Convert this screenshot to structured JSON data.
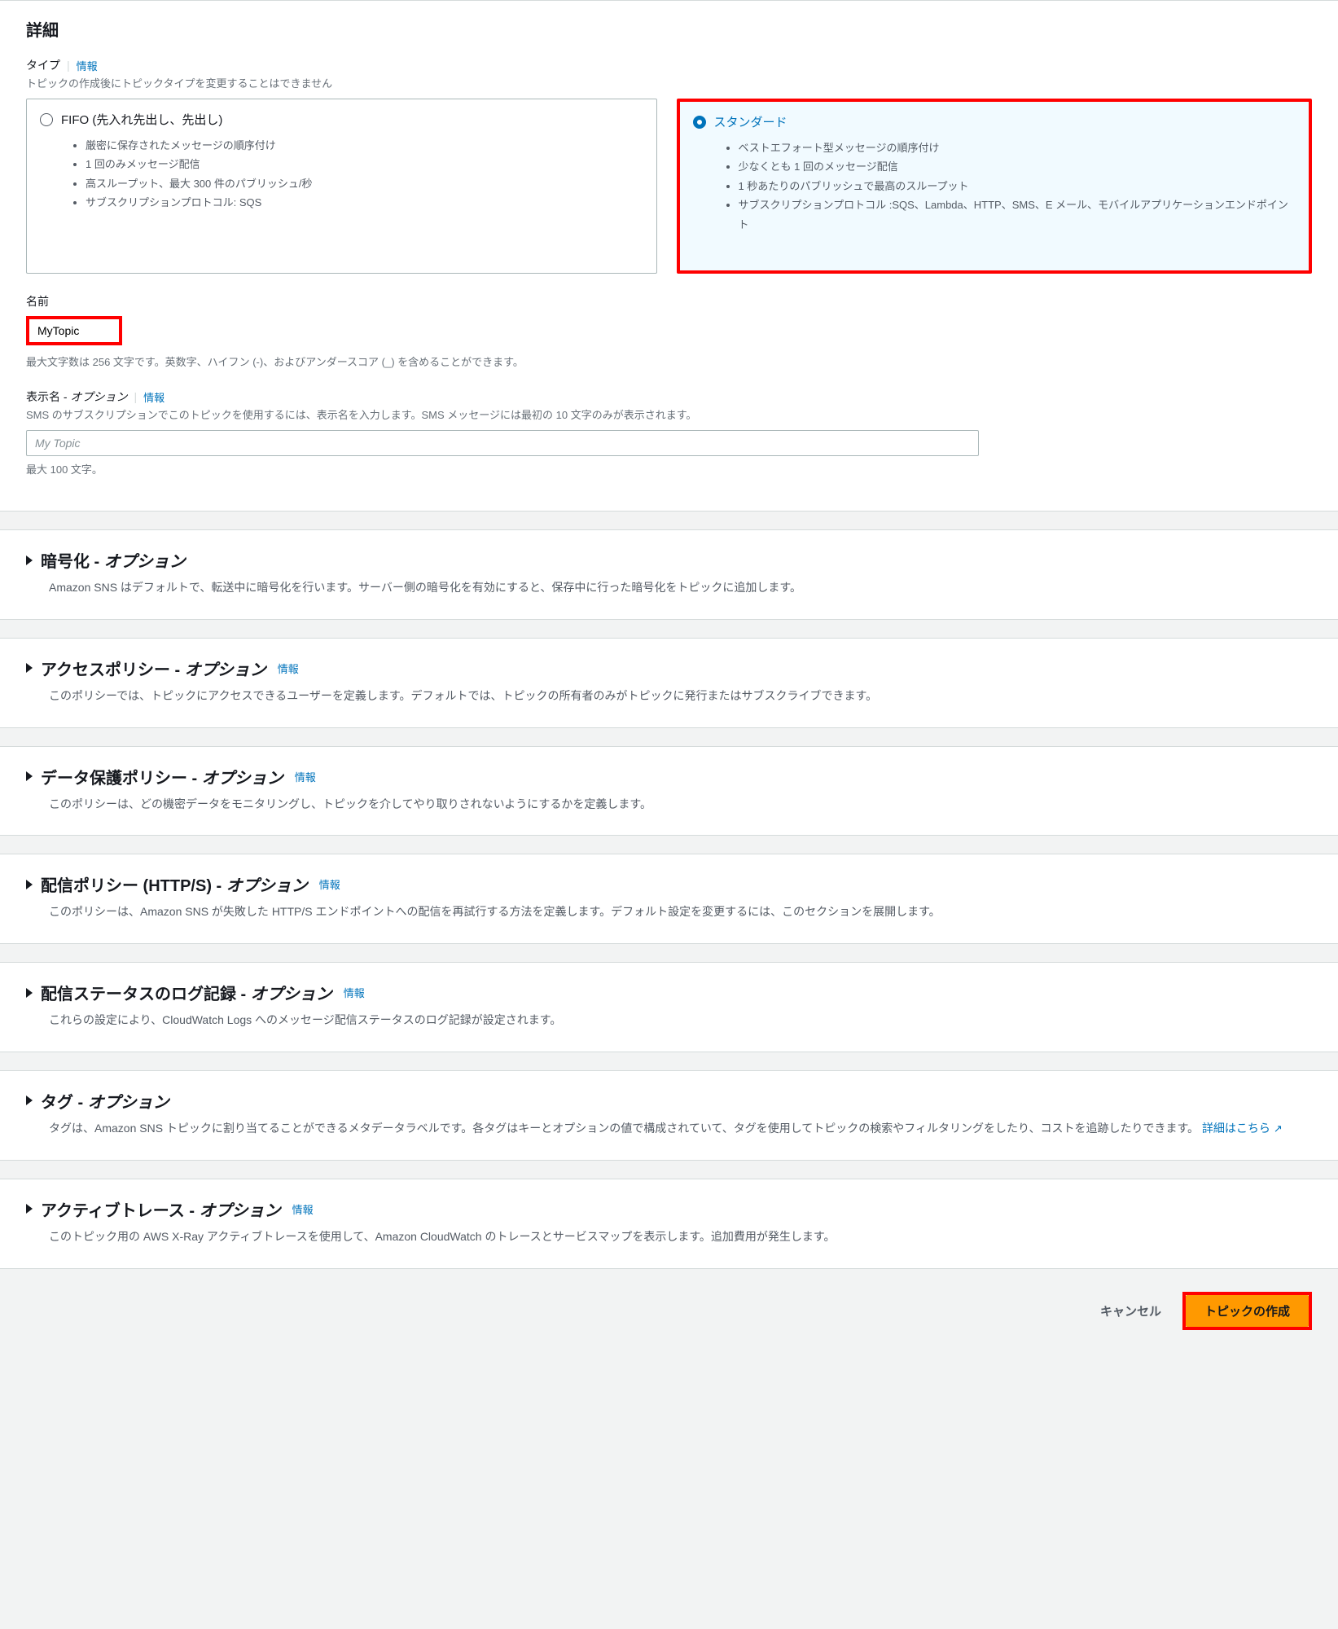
{
  "details": {
    "heading": "詳細",
    "type": {
      "label": "タイプ",
      "info": "情報",
      "desc": "トピックの作成後にトピックタイプを変更することはできません",
      "fifo": {
        "label": "FIFO (先入れ先出し、先出し)",
        "bullets": [
          "厳密に保存されたメッセージの順序付け",
          "1 回のみメッセージ配信",
          "高スループット、最大 300 件のパブリッシュ/秒",
          "サブスクリプションプロトコル: SQS"
        ]
      },
      "standard": {
        "label": "スタンダード",
        "bullets": [
          "ベストエフォート型メッセージの順序付け",
          "少なくとも 1 回のメッセージ配信",
          "1 秒あたりのパブリッシュで最高のスループット",
          "サブスクリプションプロトコル :SQS、Lambda、HTTP、SMS、E メール、モバイルアプリケーションエンドポイント"
        ]
      }
    },
    "name": {
      "label": "名前",
      "value": "MyTopic",
      "hint": "最大文字数は 256 文字です。英数字、ハイフン (-)、およびアンダースコア (_) を含めることができます。"
    },
    "displayName": {
      "label": "表示名 - ",
      "optional": "オプション",
      "info": "情報",
      "desc": "SMS のサブスクリプションでこのトピックを使用するには、表示名を入力します。SMS メッセージには最初の 10 文字のみが表示されます。",
      "placeholder": "My Topic",
      "hint": "最大 100 文字。"
    }
  },
  "sections": {
    "encryption": {
      "title": "暗号化 - ",
      "optional": "オプション",
      "desc": "Amazon SNS はデフォルトで、転送中に暗号化を行います。サーバー側の暗号化を有効にすると、保存中に行った暗号化をトピックに追加します。"
    },
    "accessPolicy": {
      "title": "アクセスポリシー - ",
      "optional": "オプション",
      "info": "情報",
      "desc": "このポリシーでは、トピックにアクセスできるユーザーを定義します。デフォルトでは、トピックの所有者のみがトピックに発行またはサブスクライブできます。"
    },
    "dataProtection": {
      "title": "データ保護ポリシー - ",
      "optional": "オプション",
      "info": "情報",
      "desc": "このポリシーは、どの機密データをモニタリングし、トピックを介してやり取りされないようにするかを定義します。"
    },
    "delivery": {
      "title": "配信ポリシー (HTTP/S) - ",
      "optional": "オプション",
      "info": "情報",
      "desc": "このポリシーは、Amazon SNS が失敗した HTTP/S エンドポイントへの配信を再試行する方法を定義します。デフォルト設定を変更するには、このセクションを展開します。"
    },
    "deliveryStatus": {
      "title": "配信ステータスのログ記録 - ",
      "optional": "オプション",
      "info": "情報",
      "desc": "これらの設定により、CloudWatch Logs へのメッセージ配信ステータスのログ記録が設定されます。"
    },
    "tags": {
      "title": "タグ - ",
      "optional": "オプション",
      "descPart1": "タグは、Amazon SNS トピックに割り当てることができるメタデータラベルです。各タグはキーとオプションの値で構成されていて、タグを使用してトピックの検索やフィルタリングをしたり、コストを追跡したりできます。",
      "link": "詳細はこちら "
    },
    "activeTrace": {
      "title": "アクティブトレース - ",
      "optional": "オプション",
      "info": "情報",
      "desc": "このトピック用の AWS X-Ray アクティブトレースを使用して、Amazon CloudWatch のトレースとサービスマップを表示します。追加費用が発生します。"
    }
  },
  "footer": {
    "cancel": "キャンセル",
    "create": "トピックの作成"
  }
}
